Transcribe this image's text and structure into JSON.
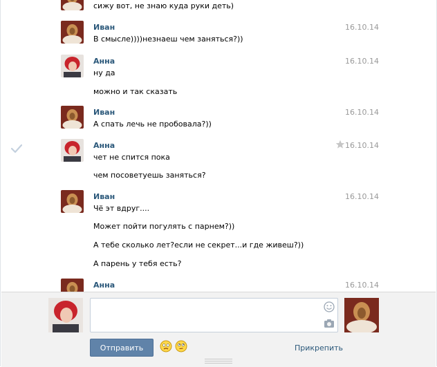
{
  "history": {
    "top_partial_text": "сижу вот, не знаю куда руки деть)",
    "messages": [
      {
        "author": "Иван",
        "date": "16.10.14",
        "lines": [
          "В смысле))))незнаеш чем заняться?))"
        ]
      },
      {
        "author": "Анна",
        "date": "16.10.14",
        "lines": [
          "ну да",
          "можно и так сказать"
        ]
      },
      {
        "author": "Иван",
        "date": "16.10.14",
        "lines": [
          "А спать лечь не пробовала?))"
        ]
      },
      {
        "author": "Анна",
        "date": "16.10.14",
        "lines": [
          "чет не спится пока",
          "чем посоветуешь заняться?"
        ]
      },
      {
        "author": "Иван",
        "date": "16.10.14",
        "lines": [
          "Чё эт вдруг....",
          "Может пойти погулять с парнем?))",
          "А тебе сколько лет?если не секрет...и где живеш?))",
          "А парень у тебя есть?"
        ]
      },
      {
        "author": "Анна",
        "date": "16.10.14",
        "lines": []
      }
    ]
  },
  "compose": {
    "send_label": "Отправить",
    "attach_label": "Прикрепить"
  },
  "colors": {
    "author": "#2b587a",
    "date": "#999999",
    "send_bg": "#6083a9"
  }
}
